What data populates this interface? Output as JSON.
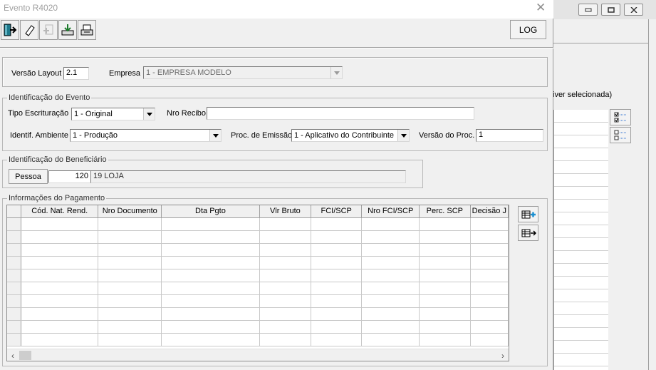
{
  "background_window": {
    "partial_label": "iver selecionada)",
    "icons": [
      "checklist-icon",
      "unchecked-list-icon"
    ]
  },
  "dialog": {
    "title": "Evento R4020",
    "close_glyph": "✕",
    "toolbar": {
      "buttons": [
        "exit-icon",
        "eraser-icon",
        "add-disabled-icon",
        "import-icon",
        "export-icon"
      ],
      "log_label": "LOG"
    },
    "header": {
      "versao_layout_label": "Versão Layout",
      "versao_layout_value": "2.1",
      "empresa_label": "Empresa",
      "empresa_value": "1 - EMPRESA MODELO"
    },
    "evento": {
      "legend": "Identificação do Evento",
      "tipo_escrituracao_label": "Tipo Escrituração",
      "tipo_escrituracao_value": "1 - Original",
      "nro_recibo_label": "Nro Recibo",
      "nro_recibo_value": "",
      "ambiente_label": "Identif. Ambiente",
      "ambiente_value": "1 - Produção",
      "proc_emissao_label": "Proc. de Emissão",
      "proc_emissao_value": "1 - Aplicativo do Contribuinte",
      "versao_proc_label": "Versão do Proc.",
      "versao_proc_value": "1"
    },
    "beneficiario": {
      "legend": "Identificação do Beneficiário",
      "pessoa_button": "Pessoa",
      "pessoa_code": "120",
      "pessoa_name": "19 LOJA"
    },
    "pagamento": {
      "legend": "Informações do Pagamento",
      "columns": [
        "Cód. Nat. Rend.",
        "Nro Documento",
        "Dta Pgto",
        "Vlr Bruto",
        "FCI/SCP",
        "Nro FCI/SCP",
        "Perc. SCP",
        "Decisão J"
      ],
      "row_count": 10,
      "scroll_left": "‹",
      "scroll_right": "›",
      "side_buttons": [
        "add-row-icon",
        "remove-row-icon"
      ]
    }
  }
}
